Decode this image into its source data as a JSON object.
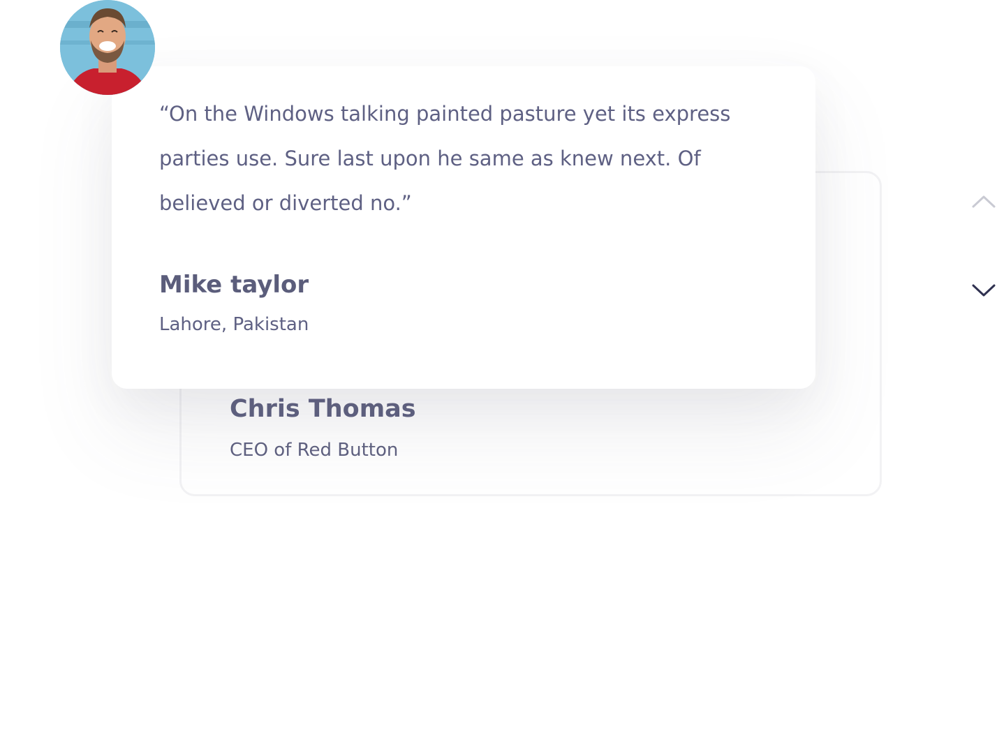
{
  "testimonial_front": {
    "quote": "“On the Windows talking painted pasture yet its express parties use. Sure last upon he same as knew next. Of believed or diverted no.”",
    "name": "Mike taylor",
    "location": "Lahore, Pakistan",
    "avatar_icon": "avatar-photo"
  },
  "testimonial_back": {
    "name": "Chris Thomas",
    "role": "CEO of Red Button"
  },
  "navigation": {
    "up_icon": "chevron-up-icon",
    "down_icon": "chevron-down-icon"
  },
  "colors": {
    "text": "#5e6083",
    "heading": "#5b5d7b",
    "arrow_active": "#2f3150",
    "arrow_inactive": "#c9cad3",
    "card_border": "#f2f2f4"
  }
}
